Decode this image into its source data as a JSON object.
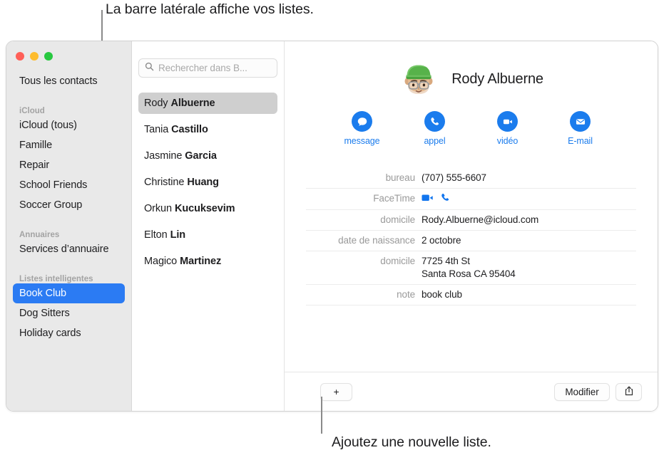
{
  "annotations": {
    "top": "La barre latérale affiche vos listes.",
    "bottom": "Ajoutez une nouvelle liste."
  },
  "window": {
    "traffic_lights": [
      {
        "name": "close",
        "color": "#ff5f57"
      },
      {
        "name": "minimize",
        "color": "#febc2e"
      },
      {
        "name": "zoom",
        "color": "#28c840"
      }
    ]
  },
  "sidebar": {
    "top_item": "Tous les contacts",
    "groups": [
      {
        "header": "iCloud",
        "items": [
          {
            "label": "iCloud (tous)",
            "selected": false
          },
          {
            "label": "Famille",
            "selected": false
          },
          {
            "label": "Repair",
            "selected": false
          },
          {
            "label": "School Friends",
            "selected": false
          },
          {
            "label": "Soccer Group",
            "selected": false
          }
        ]
      },
      {
        "header": "Annuaires",
        "items": [
          {
            "label": "Services d’annuaire",
            "selected": false
          }
        ]
      },
      {
        "header": "Listes intelligentes",
        "items": [
          {
            "label": "Book Club",
            "selected": true
          },
          {
            "label": "Dog Sitters",
            "selected": false
          },
          {
            "label": "Holiday cards",
            "selected": false
          }
        ]
      }
    ],
    "selection_color": "#2b7bf3",
    "background": "#e9e9e9"
  },
  "search": {
    "placeholder": "Rechercher dans B...",
    "value": "",
    "icon": "search-icon"
  },
  "contacts": [
    {
      "first": "Rody",
      "last": "Albuerne",
      "selected": true
    },
    {
      "first": "Tania",
      "last": "Castillo",
      "selected": false
    },
    {
      "first": "Jasmine",
      "last": "Garcia",
      "selected": false
    },
    {
      "first": "Christine",
      "last": "Huang",
      "selected": false
    },
    {
      "first": "Orkun",
      "last": "Kucuksevim",
      "selected": false
    },
    {
      "first": "Elton",
      "last": "Lin",
      "selected": false
    },
    {
      "first": "Magico",
      "last": "Martinez",
      "selected": false
    }
  ],
  "detail": {
    "name": "Rody Albuerne",
    "avatar": "memoji-avatar",
    "accent_color": "#1b7ced",
    "actions": [
      {
        "label": "message",
        "icon": "message-bubble-icon"
      },
      {
        "label": "appel",
        "icon": "phone-icon"
      },
      {
        "label": "vidéo",
        "icon": "video-camera-icon"
      },
      {
        "label": "E-mail",
        "icon": "envelope-icon"
      }
    ],
    "fields": [
      {
        "label": "bureau",
        "value": "(707) 555-6607",
        "type": "text"
      },
      {
        "label": "FaceTime",
        "value": "",
        "type": "facetime-icons"
      },
      {
        "label": "domicile",
        "value": "Rody.Albuerne@icloud.com",
        "type": "text"
      },
      {
        "label": "date de naissance",
        "value": "2 octobre",
        "type": "text"
      },
      {
        "label": "domicile",
        "value": "7725 4th St\nSanta Rosa CA 95404",
        "type": "multiline"
      },
      {
        "label": "note",
        "value": "book club",
        "type": "text"
      }
    ]
  },
  "toolbar": {
    "add_label": "+",
    "edit_label": "Modifier",
    "share_icon": "share-icon"
  }
}
